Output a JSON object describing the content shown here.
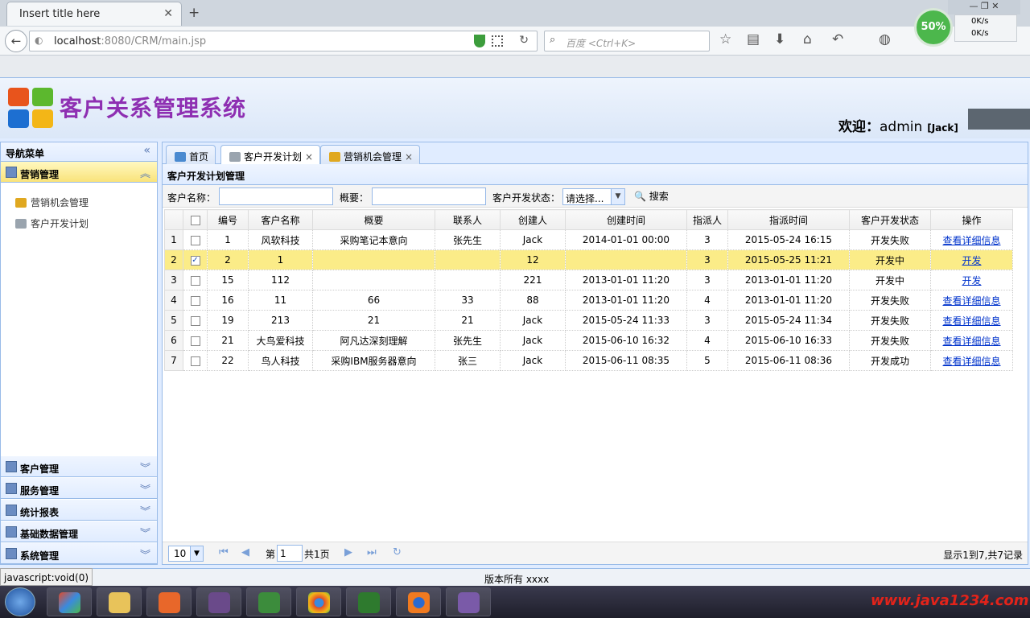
{
  "browser": {
    "tab_title": "Insert title here",
    "tab_close": "✕",
    "new_tab": "+",
    "url_host": "localhost",
    "url_rest": ":8080/CRM/main.jsp",
    "search_placeholder": "百度 <Ctrl+K>",
    "speed_percent": "50%",
    "speed_up": "0K/s",
    "speed_down": "0K/s"
  },
  "app": {
    "title": "客户关系管理系统",
    "welcome_label": "欢迎：",
    "welcome_user": "admin",
    "welcome_role": "[Jack]",
    "footer": "版本所有 xxxx"
  },
  "sidebar": {
    "title": "导航菜单",
    "active_section": "营销管理",
    "items": [
      "营销机会管理",
      "客户开发计划"
    ],
    "sections": [
      "客户管理",
      "服务管理",
      "统计报表",
      "基础数据管理",
      "系统管理"
    ]
  },
  "tabs": [
    "首页",
    "客户开发计划",
    "营销机会管理"
  ],
  "panel": {
    "title": "客户开发计划管理",
    "search": {
      "name_label": "客户名称：",
      "summary_label": "概要：",
      "status_label": "客户开发状态：",
      "status_value": "请选择...",
      "search_btn": "搜索"
    }
  },
  "grid": {
    "columns": [
      "编号",
      "客户名称",
      "概要",
      "联系人",
      "创建人",
      "创建时间",
      "指派人",
      "指派时间",
      "客户开发状态",
      "操作"
    ],
    "rows": [
      {
        "n": "1",
        "checked": false,
        "cells": [
          "1",
          "风软科技",
          "采购笔记本意向",
          "张先生",
          "Jack",
          "2014-01-01 00:00",
          "3",
          "2015-05-24 16:15",
          "开发失败",
          "查看详细信息"
        ]
      },
      {
        "n": "2",
        "checked": true,
        "cells": [
          "2",
          "1",
          "",
          "",
          "12",
          "",
          "3",
          "2015-05-25 11:21",
          "开发中",
          "开发"
        ]
      },
      {
        "n": "3",
        "checked": false,
        "cells": [
          "15",
          "112",
          "",
          "",
          "221",
          "2013-01-01 11:20",
          "3",
          "2013-01-01 11:20",
          "开发中",
          "开发"
        ]
      },
      {
        "n": "4",
        "checked": false,
        "cells": [
          "16",
          "11",
          "66",
          "33",
          "88",
          "2013-01-01 11:20",
          "4",
          "2013-01-01 11:20",
          "开发失败",
          "查看详细信息"
        ]
      },
      {
        "n": "5",
        "checked": false,
        "cells": [
          "19",
          "213",
          "21",
          "21",
          "Jack",
          "2015-05-24 11:33",
          "3",
          "2015-05-24 11:34",
          "开发失败",
          "查看详细信息"
        ]
      },
      {
        "n": "6",
        "checked": false,
        "cells": [
          "21",
          "大鸟爱科技",
          "阿凡达深刻理解",
          "张先生",
          "Jack",
          "2015-06-10 16:32",
          "4",
          "2015-06-10 16:33",
          "开发失败",
          "查看详细信息"
        ]
      },
      {
        "n": "7",
        "checked": false,
        "cells": [
          "22",
          "鸟人科技",
          "采购IBM服务器意向",
          "张三",
          "Jack",
          "2015-06-11 08:35",
          "5",
          "2015-06-11 08:36",
          "开发成功",
          "查看详细信息"
        ]
      }
    ]
  },
  "pager": {
    "page_size": "10",
    "page_label": "第",
    "page_value": "1",
    "total_label": "共1页",
    "info": "显示1到7,共7记录"
  },
  "statusbar": "javascript:void(0)",
  "watermark": "www.java1234.com"
}
